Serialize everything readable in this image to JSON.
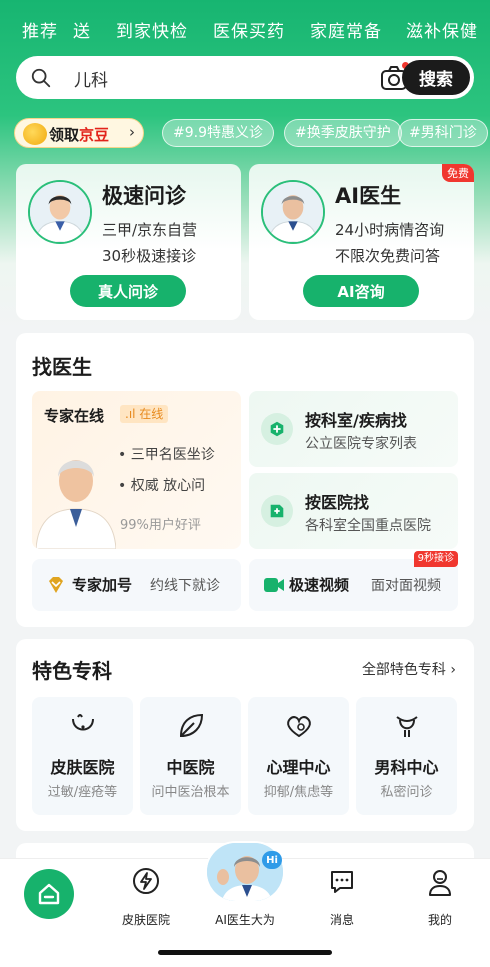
{
  "top_nav": [
    "推荐",
    "送",
    "到家快检",
    "医保买药",
    "家庭常备",
    "滋补保健"
  ],
  "search": {
    "query": "儿科",
    "button": "搜索"
  },
  "chips": {
    "bean_prefix": "领取",
    "bean_highlight": "京豆",
    "tags": [
      "#9.9特惠义诊",
      "#换季皮肤守护",
      "#男科门诊"
    ]
  },
  "consult_left": {
    "title": "极速问诊",
    "line1": "三甲/京东自营",
    "line2": "30秒极速接诊",
    "button": "真人问诊"
  },
  "consult_right": {
    "title": "AI医生",
    "line1": "24小时病情咨询",
    "line2": "不限次免费问答",
    "button": "AI咨询",
    "tag": "免费"
  },
  "find_doctor": {
    "title": "找医生",
    "expert": {
      "title": "专家在线",
      "status": "在线",
      "bullet1": "三甲名医坐诊",
      "bullet2": "权威 放心问",
      "rating": "99%用户好评"
    },
    "by_department": {
      "title": "按科室/疾病找",
      "subtitle": "公立医院专家列表"
    },
    "by_hospital": {
      "title": "按医院找",
      "subtitle": "各科室全国重点医院"
    },
    "appointment": {
      "title": "专家加号",
      "subtitle": "约线下就诊"
    },
    "video": {
      "title": "极速视频",
      "subtitle": "面对面视频",
      "badge": "9秒接诊"
    }
  },
  "special": {
    "title": "特色专科",
    "all_link": "全部特色专科",
    "items": [
      {
        "title": "皮肤医院",
        "subtitle": "过敏/痤疮等",
        "icon": "skin-icon"
      },
      {
        "title": "中医院",
        "subtitle": "问中医治根本",
        "icon": "leaf-icon"
      },
      {
        "title": "心理中心",
        "subtitle": "抑郁/焦虑等",
        "icon": "heart-icon"
      },
      {
        "title": "男科中心",
        "subtitle": "私密问诊",
        "icon": "male-icon"
      }
    ]
  },
  "tabbar": {
    "items": [
      {
        "label": "",
        "icon": "home-icon"
      },
      {
        "label": "皮肤医院",
        "icon": "lightning-icon"
      },
      {
        "label": "AI医生大为",
        "icon": "ai-doctor-avatar"
      },
      {
        "label": "消息",
        "icon": "message-icon"
      },
      {
        "label": "我的",
        "icon": "profile-icon"
      }
    ],
    "ai_badge": "Hi"
  },
  "colors": {
    "brand_green": "#17b26c",
    "alert_red": "#f0372f",
    "orange": "#e78a1e"
  }
}
